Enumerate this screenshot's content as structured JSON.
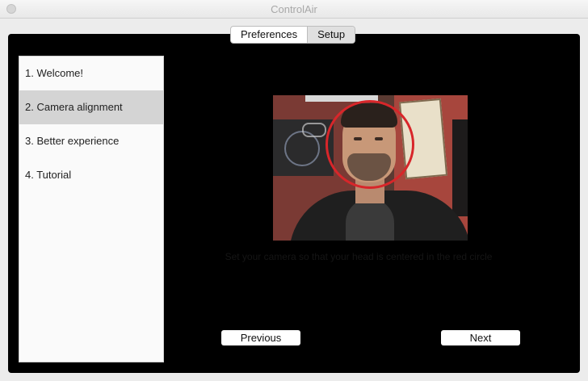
{
  "window": {
    "title": "ControlAir"
  },
  "tabs": [
    {
      "label": "Preferences",
      "selected": false
    },
    {
      "label": "Setup",
      "selected": true
    }
  ],
  "sidebar": {
    "items": [
      {
        "label": "1. Welcome!",
        "active": false
      },
      {
        "label": "2. Camera alignment",
        "active": true
      },
      {
        "label": "3. Better experience",
        "active": false
      },
      {
        "label": "4. Tutorial",
        "active": false
      }
    ]
  },
  "main": {
    "instructions": "Set your camera so that your head is centered in the red circle",
    "previous_label": "Previous",
    "next_label": "Next"
  },
  "colors": {
    "panel_background": "#000000",
    "alignment_ring": "#d8262a",
    "selected_sidebar": "#d4d4d4"
  }
}
